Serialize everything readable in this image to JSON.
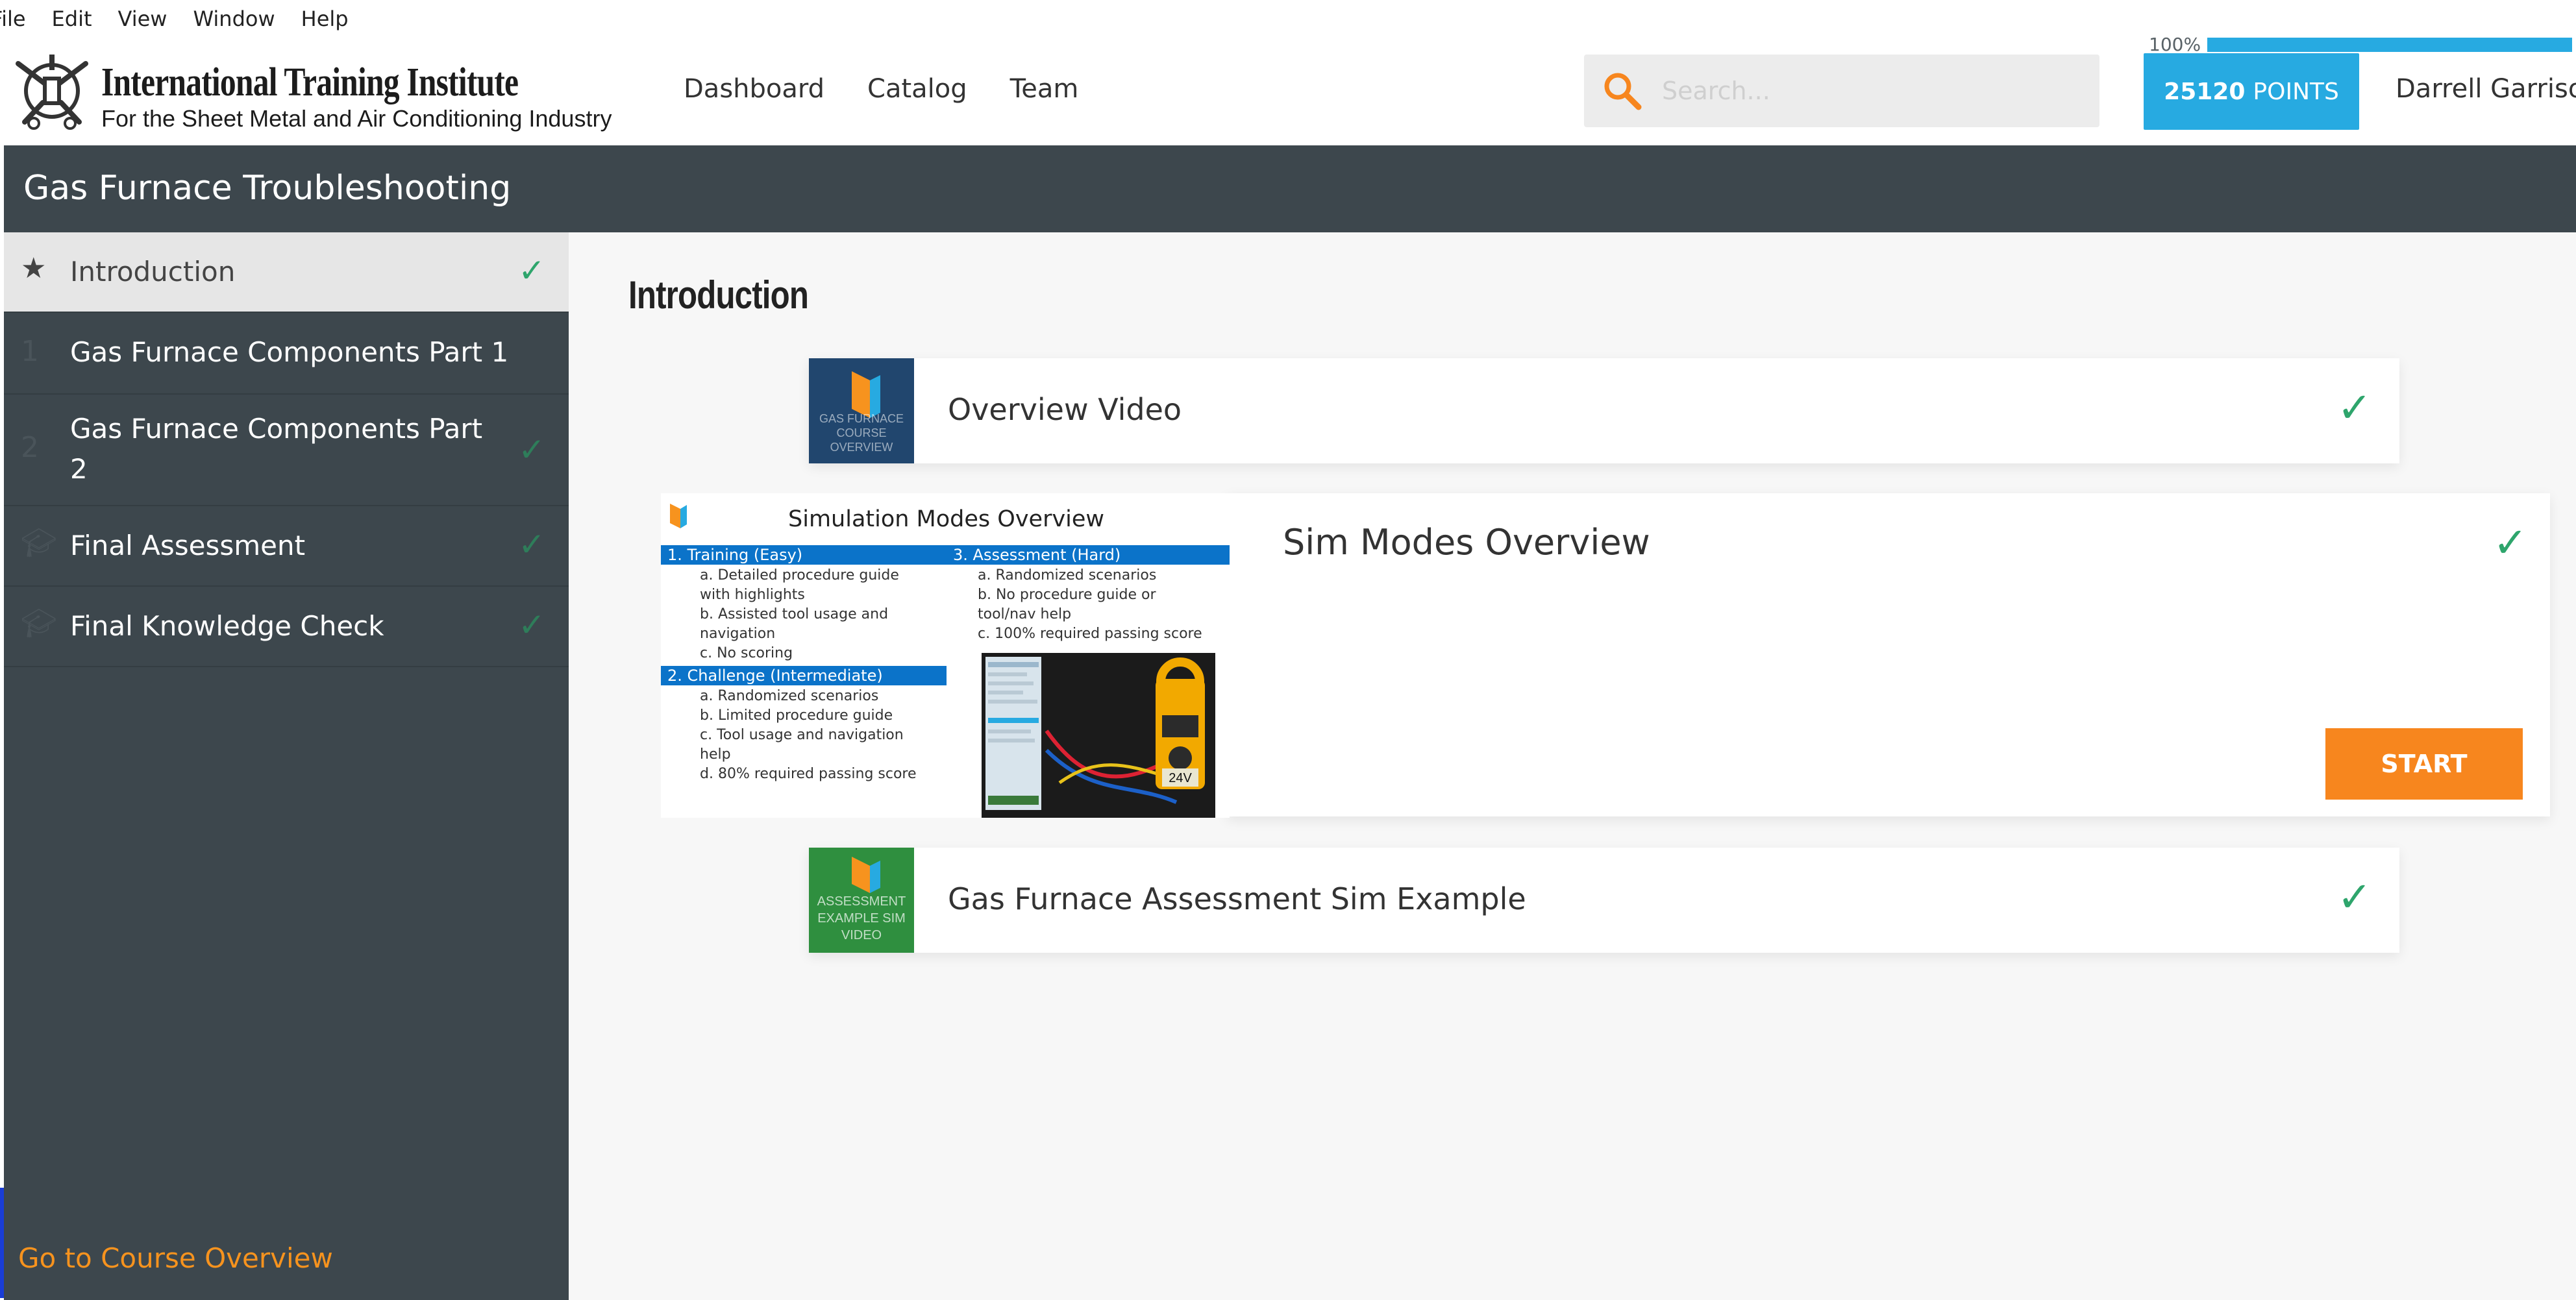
{
  "menubar": {
    "file": "File",
    "edit": "Edit",
    "view": "View",
    "window": "Window",
    "help": "Help"
  },
  "header": {
    "logo_title": "International Training Institute",
    "logo_subtitle": "For the Sheet Metal and Air Conditioning Industry",
    "nav": {
      "dashboard": "Dashboard",
      "catalog": "Catalog",
      "team": "Team"
    },
    "search_placeholder": "Search...",
    "points_value": "25120",
    "points_label": "POINTS",
    "user_name": "Darrell Garrison"
  },
  "course": {
    "title": "Gas Furnace Troubleshooting",
    "progress_label": "100%",
    "progress_fraction": 1.0
  },
  "sidebar": {
    "items": [
      {
        "label": "Introduction",
        "icon": "star-icon",
        "completed": true
      },
      {
        "label": "Gas Furnace Components Part 1",
        "icon": "number-1",
        "completed": false
      },
      {
        "label": "Gas Furnace Components Part 2",
        "icon": "number-2",
        "completed": true
      },
      {
        "label": "Final Assessment",
        "icon": "graduation-cap-icon",
        "completed": true
      },
      {
        "label": "Final Knowledge Check",
        "icon": "graduation-cap-icon",
        "completed": true
      }
    ],
    "footer_link": "Go to Course Overview"
  },
  "main": {
    "section_title": "Introduction",
    "cards": [
      {
        "title": "Overview Video",
        "thumb_text": "GAS FURNACE\nCOURSE OVERVIEW",
        "completed": true
      },
      {
        "title": "Sim Modes Overview",
        "completed": true,
        "action": "START"
      },
      {
        "title": "Gas Furnace Assessment Sim Example",
        "thumb_text": "ASSESSMENT\nEXAMPLE SIM\nVIDEO",
        "completed": true
      }
    ],
    "slide": {
      "title": "Simulation Modes Overview",
      "training_head": "1.  Training (Easy)",
      "training_items": [
        "a.  Detailed procedure guide",
        "     with highlights",
        "b.  Assisted tool usage and",
        "     navigation",
        "c.  No scoring"
      ],
      "challenge_head": "2.  Challenge (Intermediate)",
      "challenge_items": [
        "a.  Randomized scenarios",
        "b.  Limited procedure guide",
        "c.  Tool usage and navigation",
        "     help",
        "d.  80% required passing score"
      ],
      "assessment_head": "3.  Assessment (Hard)",
      "assessment_items": [
        "a.  Randomized scenarios",
        "b.  No procedure guide or",
        "     tool/nav help",
        "c.  100% required passing score"
      ],
      "meter_reading": "24V"
    }
  },
  "colors": {
    "dark_panel": "#3d474d",
    "accent_blue": "#27aae1",
    "accent_orange": "#f7861e",
    "check_green": "#2ea56c"
  }
}
